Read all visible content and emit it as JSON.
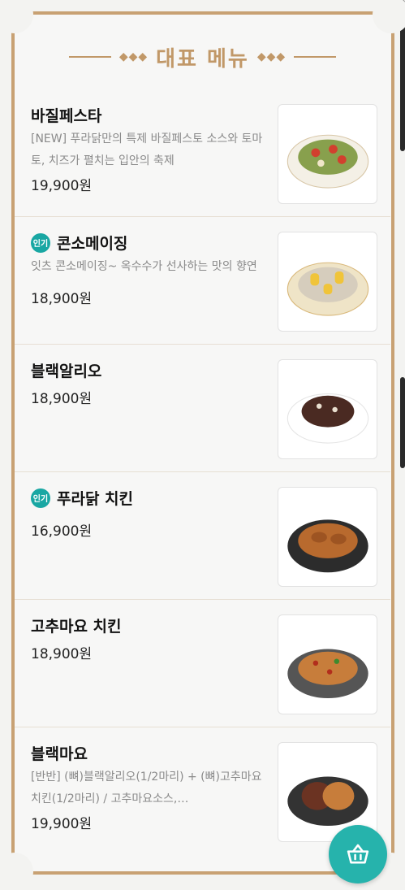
{
  "header": {
    "title": "대표 메뉴",
    "spark_left": "◆◆◆",
    "spark_right": "◆◆◆"
  },
  "items": [
    {
      "name": "바질페스타",
      "badge": "",
      "desc": "[NEW] 푸라닭만의 특제 바질페스토 소스와 토마토, 치즈가 펼치는 입안의 축제",
      "price": "19,900원",
      "food_color": "#88a04d"
    },
    {
      "name": "콘소메이징",
      "badge": "인기",
      "desc": "잇츠 콘소메이징~ 옥수수가 선사하는 맛의 향연",
      "price": "18,900원",
      "food_color": "#e0c878"
    },
    {
      "name": "블랙알리오",
      "badge": "",
      "desc": "",
      "price": "18,900원",
      "food_color": "#4a2a22"
    },
    {
      "name": "푸라닭 치킨",
      "badge": "인기",
      "desc": "",
      "price": "16,900원",
      "food_color": "#b86a2e"
    },
    {
      "name": "고추마요 치킨",
      "badge": "",
      "desc": "",
      "price": "18,900원",
      "food_color": "#c77d3b"
    },
    {
      "name": "블랙마요",
      "badge": "",
      "desc": "[반반] (뼈)블랙알리오(1/2마리) + (뼈)고추마요 치킨(1/2마리) / 고추마요소스,…",
      "price": "19,900원",
      "food_color": "#6b3322"
    }
  ],
  "colors": {
    "accent": "#c19868",
    "badge": "#19a7a3",
    "cart": "#26b3ac"
  },
  "cart": {
    "icon": "basket-icon"
  }
}
